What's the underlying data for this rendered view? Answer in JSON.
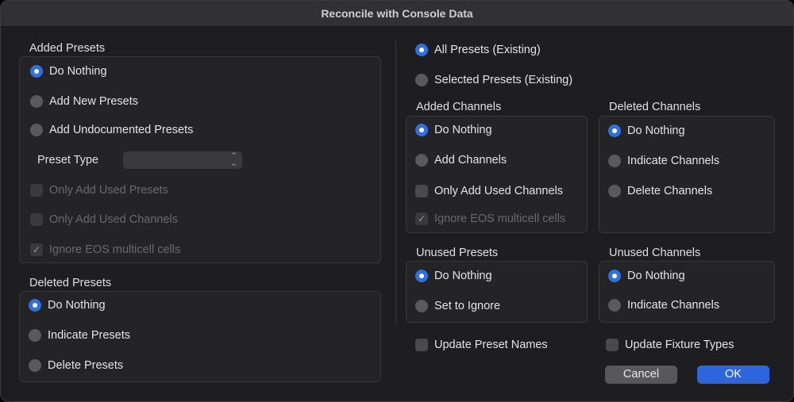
{
  "title": "Reconcile with Console Data",
  "added_presets": {
    "label": "Added Presets",
    "options": [
      "Do Nothing",
      "Add New Presets",
      "Add Undocumented Presets"
    ],
    "selected": 0,
    "preset_type_label": "Preset Type",
    "preset_type_value": "",
    "checks": [
      {
        "label": "Only Add Used Presets",
        "checked": false
      },
      {
        "label": "Only Add Used Channels",
        "checked": false
      },
      {
        "label": "Ignore EOS multicell cells",
        "checked": true
      }
    ]
  },
  "deleted_presets": {
    "label": "Deleted Presets",
    "options": [
      "Do Nothing",
      "Indicate Presets",
      "Delete Presets"
    ],
    "selected": 0
  },
  "scope": {
    "options": [
      "All Presets (Existing)",
      "Selected Presets (Existing)"
    ],
    "selected": 0
  },
  "added_channels": {
    "label": "Added Channels",
    "options": [
      "Do Nothing",
      "Add Channels"
    ],
    "selected": 0,
    "checks": [
      {
        "label": "Only Add Used Channels",
        "checked": false
      },
      {
        "label": "Ignore EOS multicell cells",
        "checked": true
      }
    ]
  },
  "deleted_channels": {
    "label": "Deleted Channels",
    "options": [
      "Do Nothing",
      "Indicate Channels",
      "Delete Channels"
    ],
    "selected": 0
  },
  "unused_presets": {
    "label": "Unused Presets",
    "options": [
      "Do Nothing",
      "Set to Ignore"
    ],
    "selected": 0
  },
  "unused_channels": {
    "label": "Unused Channels",
    "options": [
      "Do Nothing",
      "Indicate Channels"
    ],
    "selected": 0
  },
  "update_preset_names": {
    "label": "Update Preset Names",
    "checked": false
  },
  "update_fixture_types": {
    "label": "Update Fixture Types",
    "checked": false
  },
  "buttons": {
    "cancel": "Cancel",
    "ok": "OK"
  }
}
